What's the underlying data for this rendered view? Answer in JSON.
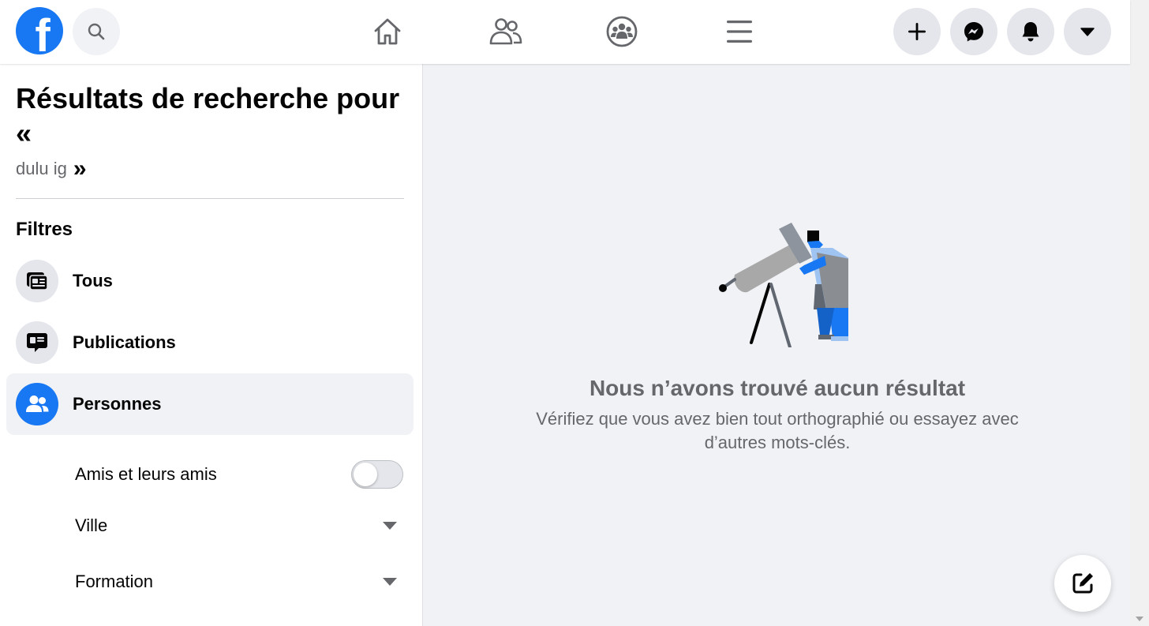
{
  "topbar": {
    "logo_letter": "f",
    "nav": [
      "home-icon",
      "friends-icon",
      "groups-icon",
      "menu-icon"
    ],
    "actions": [
      "plus-icon",
      "messenger-icon",
      "bell-icon",
      "caret-down-icon"
    ]
  },
  "search": {
    "title": "Résultats de recherche pour",
    "open_quote": "«",
    "query": "dulu ig",
    "close_quote": "»"
  },
  "filters": {
    "title": "Filtres",
    "items": [
      {
        "label": "Tous",
        "icon": "cards-icon",
        "active": false
      },
      {
        "label": "Publications",
        "icon": "post-bubble-icon",
        "active": false
      },
      {
        "label": "Personnes",
        "icon": "people-icon",
        "active": true
      }
    ],
    "sub": {
      "friends_toggle": {
        "label": "Amis et leurs amis",
        "on": false
      },
      "city": {
        "label": "Ville"
      },
      "education": {
        "label": "Formation"
      }
    }
  },
  "empty": {
    "title": "Nous n’avons trouvé aucun résultat",
    "subtitle": "Vérifiez que vous avez bien tout orthographié ou essayez avec d’autres mots-clés."
  },
  "colors": {
    "brand": "#1877f2",
    "surface": "#ffffff",
    "background": "#f0f2f5",
    "secondary_text": "#65676b"
  }
}
